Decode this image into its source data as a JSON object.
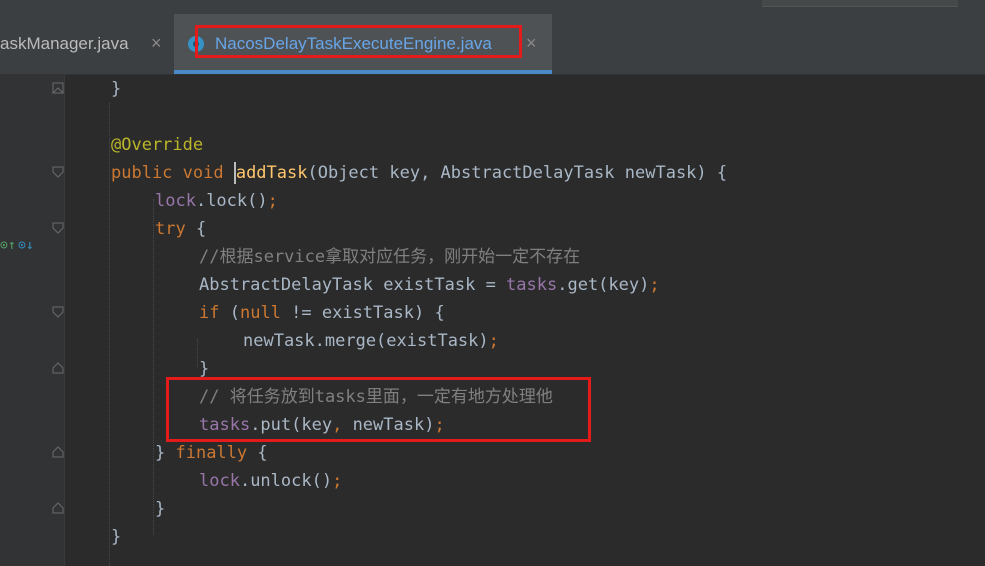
{
  "tabs": [
    {
      "label": "askManager.java",
      "close": "×"
    },
    {
      "label": "NacosDelayTaskExecuteEngine.java",
      "close": "×",
      "active": true
    }
  ],
  "code": {
    "l1": "}",
    "l3": "@Override",
    "l4": {
      "kw1": "public void ",
      "fn": "addTask",
      "rest": "(Object key, AbstractDelayTask newTask) {"
    },
    "l5": {
      "fld": "lock",
      "rest": ".lock()",
      "semi": ";"
    },
    "l6": {
      "kw": "try",
      "rest": " {"
    },
    "l7": "//根据service拿取对应任务，刚开始一定不存在",
    "l8": {
      "a": "AbstractDelayTask existTask = ",
      "fld": "tasks",
      "b": ".get(key)",
      "semi": ";"
    },
    "l9": {
      "kw1": "if",
      "a": " (",
      "kw2": "null",
      "b": " != existTask) {"
    },
    "l10": {
      "a": "newTask.merge(existTask)",
      "semi": ";"
    },
    "l11": "}",
    "l12": "// 将任务放到tasks里面，一定有地方处理他",
    "l13": {
      "fld": "tasks",
      "a": ".put(key",
      "comma": ",",
      "b": " newTask)",
      "semi": ";"
    },
    "l14": {
      "a": "} ",
      "kw": "finally",
      "b": " {"
    },
    "l15": {
      "fld": "lock",
      "a": ".unlock()",
      "semi": ";"
    },
    "l16": "}",
    "l17": "}"
  },
  "icons": [
    "java-class-icon",
    "override-icon",
    "implement-icon",
    "fold-icon",
    "close-icon"
  ]
}
